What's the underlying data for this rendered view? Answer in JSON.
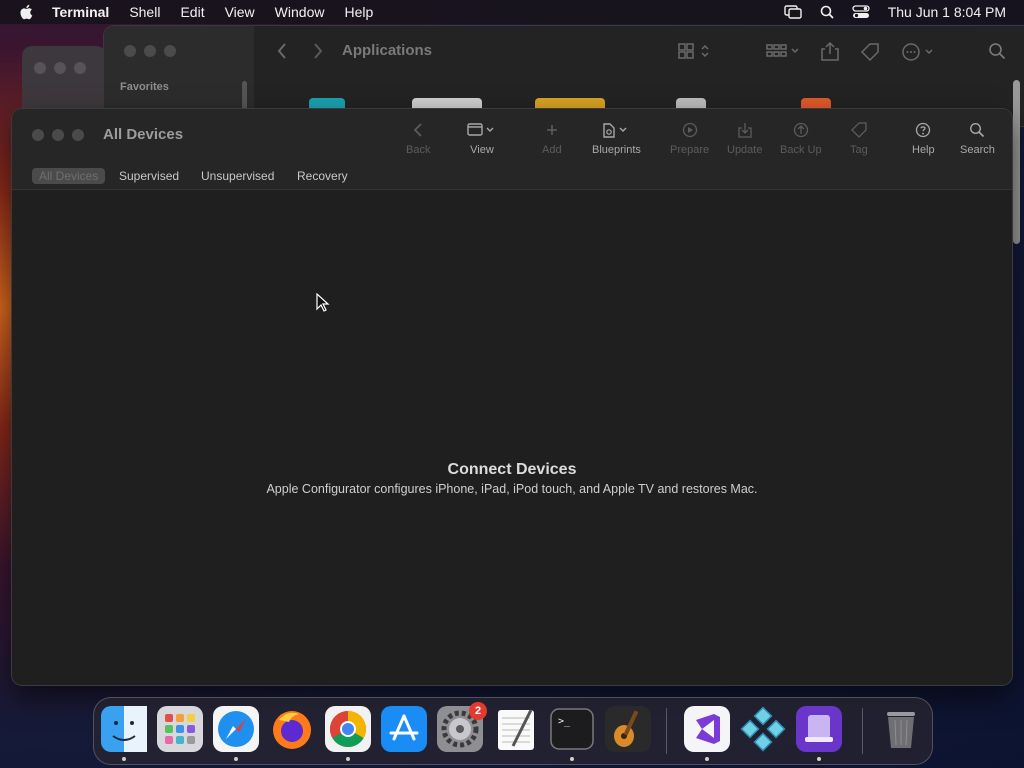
{
  "menubar": {
    "app_name": "Terminal",
    "items": [
      "Shell",
      "Edit",
      "View",
      "Window",
      "Help"
    ],
    "clock": "Thu Jun 1  8:04 PM"
  },
  "finder": {
    "title": "Applications",
    "sidebar_heading": "Favorites"
  },
  "window": {
    "title": "All Devices",
    "toolbar": [
      {
        "label": "Back",
        "icon": "chevron-left-icon",
        "enabled": false
      },
      {
        "label": "View",
        "icon": "window-icon",
        "enabled": true
      },
      {
        "label": "Add",
        "icon": "plus-icon",
        "enabled": false
      },
      {
        "label": "Blueprints",
        "icon": "blueprints-icon",
        "enabled": true
      },
      {
        "label": "Prepare",
        "icon": "prepare-icon",
        "enabled": false
      },
      {
        "label": "Update",
        "icon": "update-icon",
        "enabled": false
      },
      {
        "label": "Back Up",
        "icon": "backup-icon",
        "enabled": false
      },
      {
        "label": "Tag",
        "icon": "tag-icon",
        "enabled": false
      },
      {
        "label": "Help",
        "icon": "help-icon",
        "enabled": true
      },
      {
        "label": "Search",
        "icon": "search-icon",
        "enabled": true
      }
    ],
    "tabs": [
      "All Devices",
      "Supervised",
      "Unsupervised",
      "Recovery"
    ],
    "selected_tab": "All Devices",
    "empty_state": {
      "title": "Connect Devices",
      "subtitle": "Apple Configurator configures iPhone, iPad, iPod touch, and Apple TV and restores Mac."
    }
  },
  "dock": {
    "apps": [
      "Finder",
      "Launchpad",
      "Safari",
      "Firefox",
      "Chrome",
      "App Store",
      "System Settings",
      "TextEdit",
      "Terminal",
      "GarageBand",
      "Visual Studio",
      "PPSSPP",
      "Apple Configurator",
      "Trash"
    ],
    "system_settings_badge": "2"
  },
  "colors": {
    "window_bg": "#1f1f1f",
    "toolbar_bg": "#262626",
    "menubar_bg": "#18141c"
  }
}
